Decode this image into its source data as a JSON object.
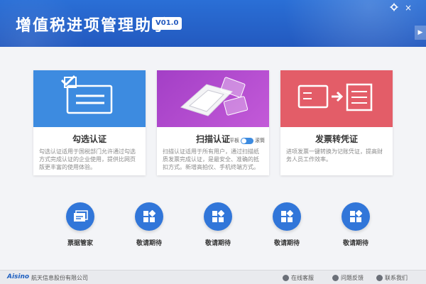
{
  "window": {
    "title": "增值税进项管理助手",
    "version": "V01.0",
    "settings_icon": "gear-icon",
    "close_label": "×",
    "expand_label": "▶"
  },
  "cards": [
    {
      "title": "勾选认证",
      "description": "勾选认证适用于国税部门允许通过勾选方式完成认证的企业使用，提供比网页版更丰富的使用体验。",
      "icon": "checklist-icon"
    },
    {
      "title": "扫描认证",
      "description": "扫描认证适用于所有用户，通过扫描纸质发票完成认证，是最安全、准确的抵扣方式。新增高拍仪、手机终端方式。",
      "icon": "scanner-icon",
      "toggle_left": "平板",
      "toggle_right": "滚筒"
    },
    {
      "title": "发票转凭证",
      "description": "进项发票一键转换为记账凭证，提高财务人员工作效率。",
      "icon": "invoice-to-voucher-icon"
    }
  ],
  "functions": [
    {
      "label": "票据管家",
      "icon": "ticket-manager-icon"
    },
    {
      "label": "敬请期待",
      "icon": "app-grid-icon"
    },
    {
      "label": "敬请期待",
      "icon": "app-grid-icon"
    },
    {
      "label": "敬请期待",
      "icon": "app-grid-icon"
    },
    {
      "label": "敬请期待",
      "icon": "app-grid-icon"
    }
  ],
  "footer": {
    "logo": "Aisino",
    "company": "航天信息股份有限公司",
    "links": [
      {
        "label": "在线客服",
        "icon": "headset-icon"
      },
      {
        "label": "问题反馈",
        "icon": "feedback-icon"
      },
      {
        "label": "联系我们",
        "icon": "phone-icon"
      }
    ]
  },
  "colors": {
    "header": "#2359bf",
    "card1": "#3d8be0",
    "card2": "#b44dd0",
    "card3": "#e35d68",
    "function_button": "#3176d9"
  }
}
